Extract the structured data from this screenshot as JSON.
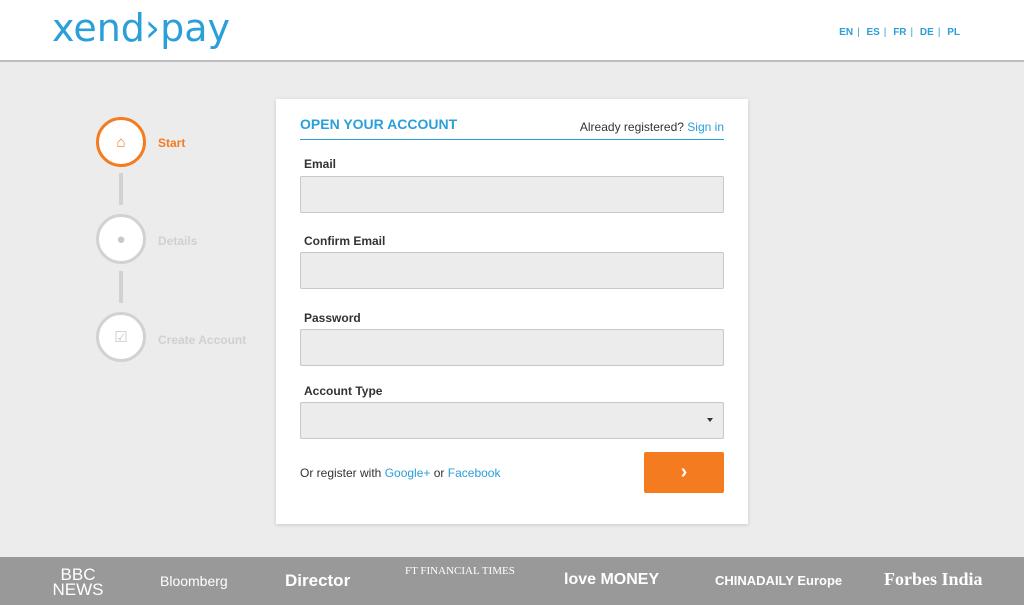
{
  "header": {
    "logo": "xend›pay",
    "languages": [
      "EN",
      "ES",
      "FR",
      "DE",
      "PL"
    ]
  },
  "steps": [
    {
      "label": "Start",
      "icon": "home-icon",
      "active": true
    },
    {
      "label": "Details",
      "icon": "user-icon",
      "active": false
    },
    {
      "label": "Create Account",
      "icon": "checkbox-icon",
      "active": false
    }
  ],
  "form": {
    "title": "OPEN YOUR ACCOUNT",
    "already_text": "Already registered?",
    "sign_in": "Sign in",
    "email_label": "Email",
    "email_value": "",
    "confirm_label": "Confirm Email",
    "confirm_value": "",
    "password_label": "Password",
    "password_value": "",
    "account_type_label": "Account Type",
    "account_type_value": "",
    "register_prefix": "Or register with",
    "google": "Google+",
    "or": "or",
    "facebook": "Facebook",
    "next_label": "›"
  },
  "colors": {
    "brand_blue": "#2a9fd8",
    "accent_orange": "#f47b20"
  },
  "footer": {
    "press": [
      "BBC NEWS",
      "Bloomberg",
      "Director",
      "FT FINANCIAL TIMES",
      "love MONEY",
      "CHINADAILY Europe",
      "Forbes India"
    ]
  }
}
